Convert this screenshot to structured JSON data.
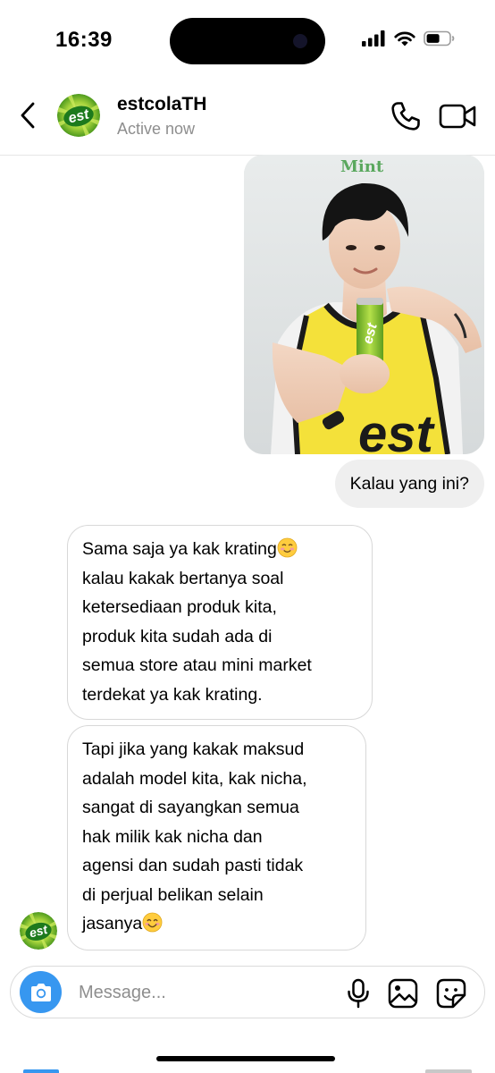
{
  "status_bar": {
    "time": "16:39",
    "icons": [
      "cellular-signal-icon",
      "wifi-icon",
      "battery-icon"
    ]
  },
  "header": {
    "name": "estcolaTH",
    "status": "Active now",
    "icons": [
      "back-chevron-icon",
      "phone-icon",
      "video-camera-icon"
    ]
  },
  "chat": {
    "photo_caption": "Mint",
    "outgoing_message": "Kalau yang ini?",
    "incoming_messages": [
      {
        "lines": [
          "Sama saja ya kak krating",
          "kalau kakak bertanya soal",
          "ketersediaan produk kita,",
          "produk kita sudah ada di",
          "semua store atau mini market",
          "terdekat ya kak krating."
        ],
        "emoji": "smiling-face-icon"
      },
      {
        "lines": [
          "Tapi jika yang kakak maksud",
          "adalah model kita, kak nicha,",
          "sangat di sayangkan semua",
          "hak milik kak nicha dan",
          "agensi dan sudah pasti tidak",
          "di perjual belikan selain",
          "jasanya"
        ],
        "emoji": "smiling-face-with-smiling-eyes-icon"
      }
    ]
  },
  "composer": {
    "placeholder": "Message...",
    "icons": [
      "camera-icon",
      "microphone-icon",
      "gallery-icon",
      "sticker-icon"
    ]
  },
  "colors": {
    "accent_blue": "#3797f0",
    "outgoing_bubble": "#efefef",
    "secondary_text": "#8e8e8e",
    "brand_green": "#7cc242"
  }
}
